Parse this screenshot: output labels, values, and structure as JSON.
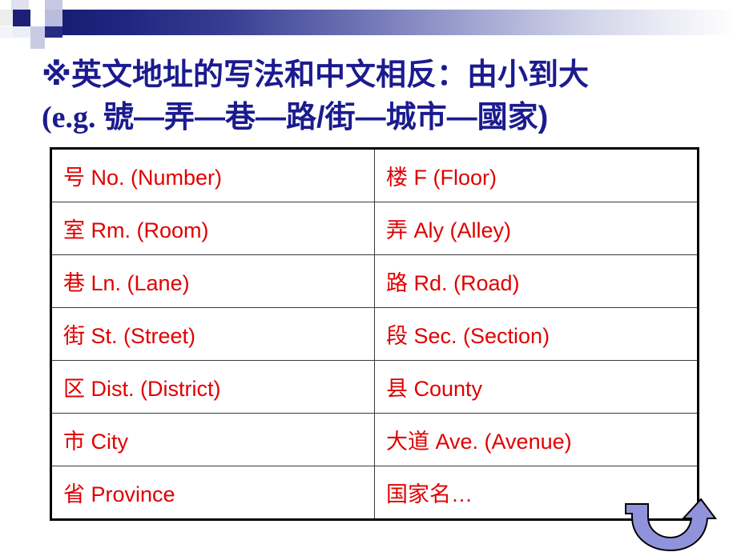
{
  "slide": {
    "title_line1": "※英文地址的写法和中文相反：由小到大",
    "title_line2_prefix": "(e.g. ",
    "title_line2_rest": "號—弄—巷—路/街—城市—國家)",
    "title_color": "#1b1b8f",
    "text_color": "#e00000",
    "accent_dark_blue": "#1d1f78",
    "arrow_fill": "#9093dc",
    "arrow_stroke": "#000000"
  },
  "table": {
    "rows": [
      {
        "left": "号 No. (Number)",
        "right": "楼 F (Floor)"
      },
      {
        "left": "室 Rm. (Room)",
        "right": "弄 Aly (Alley)"
      },
      {
        "left": "巷 Ln. (Lane)",
        "right": "路 Rd. (Road)"
      },
      {
        "left": "街 St. (Street)",
        "right": "段 Sec. (Section)"
      },
      {
        "left": "区 Dist. (District)",
        "right": "县 County"
      },
      {
        "left": "市 City",
        "right": "大道 Ave. (Avenue)"
      },
      {
        "left": "省 Province",
        "right": "国家名…"
      }
    ]
  }
}
